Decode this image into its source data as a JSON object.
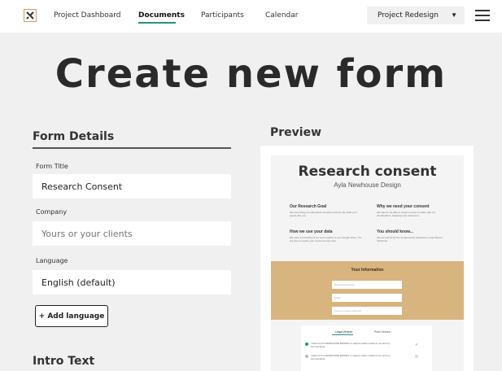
{
  "nav": {
    "links": [
      "Project Dashboard",
      "Documents",
      "Participants",
      "Calendar"
    ],
    "active": "Documents",
    "project_select": "Project Redesign"
  },
  "page": {
    "title": "Create new form"
  },
  "form": {
    "section_title": "Form Details",
    "fields": [
      {
        "label": "Form Title",
        "value": "Research Consent",
        "placeholder": ""
      },
      {
        "label": "Company",
        "value": "",
        "placeholder": "Yours or your clients"
      },
      {
        "label": "Language",
        "value": "English (default)",
        "placeholder": ""
      }
    ],
    "add_language_label": "+ Add language",
    "intro_title": "Intro Text"
  },
  "preview": {
    "title": "Preview",
    "doc_title": "Research consent",
    "doc_subtitle": "Ayla Newhouse Design",
    "blocks": [
      {
        "heading": "Our Research Goal",
        "text": "We are looking to understand ourselves and we can build a for people like you."
      },
      {
        "heading": "Why we need your consent",
        "text": "We want to be able to create a report to share with our shareholders, featuring new customers."
      },
      {
        "heading": "How we use your data",
        "text": "We store a transcript of our conversation on our Google Drive. You are free to revoke your consent at any time."
      },
      {
        "heading": "You should know...",
        "text": "We are owned by the conglomerate Newhouse Lovett Baxter Industries."
      }
    ],
    "info_title": "Your Information",
    "info_fields": [
      "Name first and last",
      "Email",
      "Phone number (optional)"
    ],
    "tabs": [
      "Legal Version",
      "Plain Version"
    ],
    "consent_rows": [
      "I allow AYLA NEWHOUSE DESIGN to capture audio media of me and my surroundings.",
      "I allow AYLA NEWHOUSE DESIGN to capture video media of me and my surroundings."
    ],
    "colors": {
      "accent": "#2a8f86",
      "info_bg": "#d8b47e"
    }
  }
}
